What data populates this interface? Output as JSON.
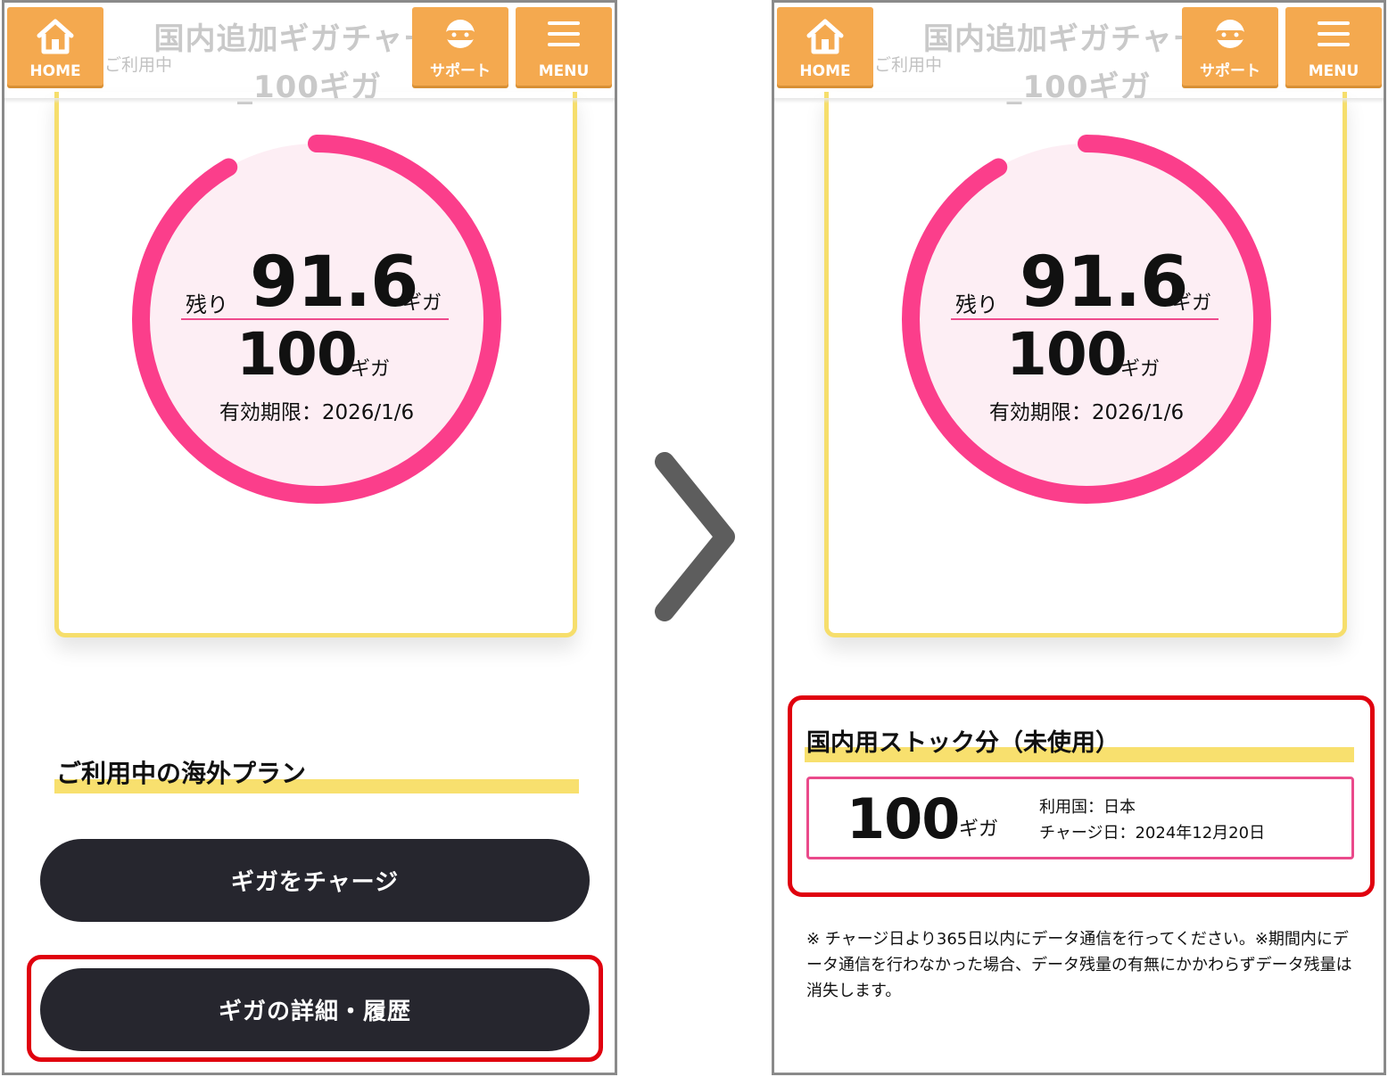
{
  "header": {
    "title_line1": "国内追加ギガチャージ",
    "title_line2": "_100ギガ",
    "status": "ご利用中",
    "home_label": "HOME",
    "support_label": "サポート",
    "menu_label": "MENU"
  },
  "gauge": {
    "remaining_label": "残り",
    "remaining_value": "91.6",
    "remaining_unit": "ギガ",
    "total_value": "100",
    "total_unit": "ギガ",
    "expiry": "有効期限：2026/1/6",
    "fraction_remaining": 0.916,
    "ring_color": "#fb3e8b",
    "fill_color": "#fdeef4"
  },
  "left_panel": {
    "section_title": "ご利用中の海外プラン",
    "charge_button": "ギガをチャージ",
    "detail_button": "ギガの詳細・履歴"
  },
  "right_panel": {
    "stock_title": "国内用ストック分（未使用）",
    "stock_value": "100",
    "stock_unit": "ギガ",
    "country": "利用国：日本",
    "charge_date": "チャージ日：2024年12月20日",
    "note": "※ チャージ日より365日以内にデータ通信を行ってください。※期間内にデータ通信を行わなかった場合、データ残量の有無にかかわらずデータ残量は消失します。"
  },
  "colors": {
    "accent_orange": "#f4a94f",
    "highlight_red": "#e0000e",
    "yellow": "#f8e06e",
    "pink": "#ea4a8b",
    "button_dark": "#26262e"
  },
  "icons": [
    "home-icon",
    "support-icon",
    "menu-icon",
    "chevron-right-icon"
  ]
}
